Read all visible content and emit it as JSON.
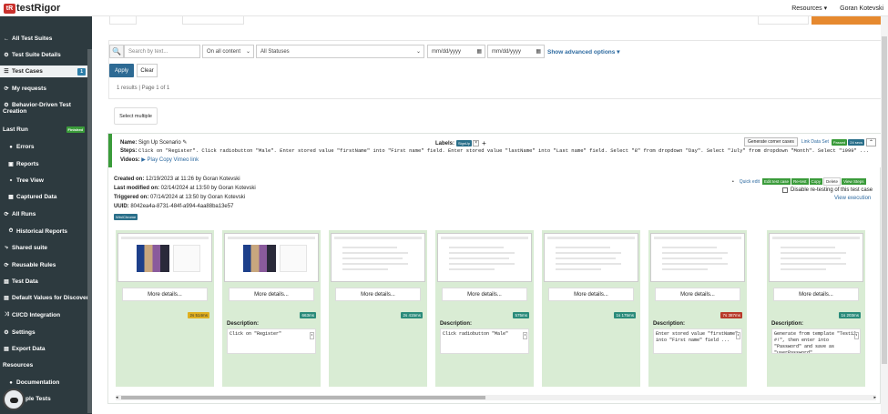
{
  "app": {
    "logo_mark": "tR",
    "logo_text": "testRigor"
  },
  "topbar": {
    "resources": "Resources ▾",
    "user": "Goran Kotevski"
  },
  "sidebar": {
    "items": [
      {
        "label": "All Test Suites",
        "icon": "←"
      },
      {
        "label": "Test Suite Details",
        "icon": "⚙"
      },
      {
        "label": "Test Cases",
        "icon": "☰",
        "badge": "1"
      },
      {
        "label": "My requests",
        "icon": "⟳"
      },
      {
        "label": "Behavior-Driven Test",
        "label2": "Creation",
        "icon": "⚙"
      },
      {
        "label": "Last Run",
        "icon": "",
        "status": "Finished"
      },
      {
        "label": "Errors",
        "icon": "●"
      },
      {
        "label": "Reports",
        "icon": "▣"
      },
      {
        "label": "Tree View",
        "icon": "⚬"
      },
      {
        "label": "Captured Data",
        "icon": "▦"
      },
      {
        "label": "All Runs",
        "icon": "⟳"
      },
      {
        "label": "Historical Reports",
        "icon": "⏱"
      },
      {
        "label": "Shared suite",
        "icon": "⤷"
      },
      {
        "label": "Reusable Rules",
        "icon": "⟳"
      },
      {
        "label": "Test Data",
        "icon": "▤"
      },
      {
        "label": "Default Values for Discovery",
        "icon": "▤"
      },
      {
        "label": "CI/CD Integration",
        "icon": "⤨"
      },
      {
        "label": "Settings",
        "icon": "⚙"
      },
      {
        "label": "Export Data",
        "icon": "▤"
      },
      {
        "label": "Resources",
        "icon": ""
      },
      {
        "label": "Documentation",
        "icon": "●"
      },
      {
        "label": "ple Tests",
        "icon": ""
      }
    ]
  },
  "filters": {
    "search_placeholder": "Search by text...",
    "content": "On all content",
    "status": "All Statuses",
    "date_from": "mm/dd/yyyy",
    "date_to": "mm/dd/yyyy",
    "advanced": "Show advanced options ▾",
    "apply": "Apply",
    "clear": "Clear",
    "results": "1 results | Page 1 of 1",
    "select_multiple": "Select multiple"
  },
  "testcase": {
    "name_label": "Name:",
    "name": "Sign Up Scenario",
    "steps_label": "Steps:",
    "steps": "Click on \"Register\". Click radiobutton \"Male\". Enter stored value \"firstName\" into \"First name\" field. Enter stored value \"lastName\" into \"Last name\" field. Select \"8\" from dropdown \"Day\". Select \"July\" from dropdown \"Month\". Select \"1999\" ...",
    "videos_label": "Videos:",
    "videos": "▶ Play Copy Vimeo link",
    "labels_label": "Labels:",
    "label_tag": "SignUp",
    "gen_corner": "Generate corner cases",
    "link_data": "Link Data Set",
    "passed": "Passed",
    "secs": "24 secs",
    "created_label": "Created on:",
    "created": "12/19/2023 at 11:26 by Goran Kotevski",
    "modified_label": "Last modified on:",
    "modified": "02/14/2024 at 13:50 by Goran Kotevski",
    "triggered_label": "Triggered on:",
    "triggered": "07/14/2024 at 13:50 by Goran Kotevski",
    "uuid_label": "UUID:",
    "uuid": "8042ea4a-8731-484f-a994-4aa88ba13e57",
    "browser": "Win/Chrome",
    "quick_edit": "Quick edit",
    "edit_test_case": "Edit test case",
    "re_test": "Re-test",
    "copy": "Copy",
    "delete": "Delete",
    "view_steps": "View Steps",
    "disable_retest": "Disable re-testing of this test case",
    "view_execution": "View execution"
  },
  "steps_grid": {
    "more_label": "More details...",
    "description_label": "Description:",
    "items": [
      {
        "duration": "2s 514ms",
        "duration_kind": "warn",
        "thumb": "hero",
        "description": ""
      },
      {
        "duration": "663ms",
        "duration_kind": "ok",
        "thumb": "hero",
        "description": "Click on \"Register\""
      },
      {
        "duration": "2s 415ms",
        "duration_kind": "ok",
        "thumb": "form",
        "description": ""
      },
      {
        "duration": "575ms",
        "duration_kind": "ok",
        "thumb": "form",
        "description": "Click radiobutton \"Male\""
      },
      {
        "duration": "1s 175ms",
        "duration_kind": "ok",
        "thumb": "form",
        "description": ""
      },
      {
        "duration": "7s 387ms",
        "duration_kind": "err",
        "thumb": "form",
        "description": "Enter stored value \"firstName\" into \"First name\" field ..."
      },
      {
        "duration": "1s 203ms",
        "duration_kind": "ok",
        "thumb": "form",
        "description": "Generate from template \"Test12 #!\", then enter into \"Password\" and save as \"userPassword\""
      }
    ]
  }
}
